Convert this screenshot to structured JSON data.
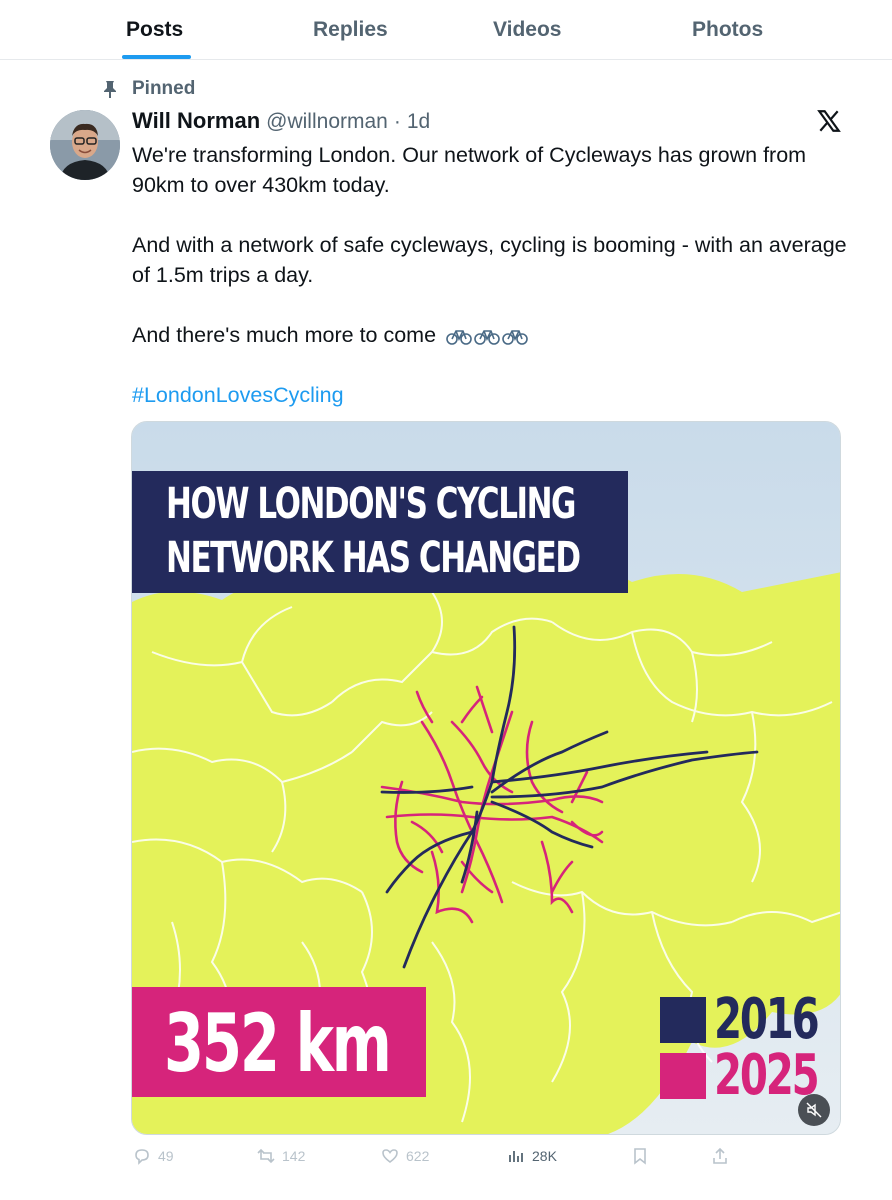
{
  "tabs": [
    {
      "label": "Posts",
      "active": true
    },
    {
      "label": "Replies",
      "active": false
    },
    {
      "label": "Videos",
      "active": false
    },
    {
      "label": "Photos",
      "active": false
    }
  ],
  "pinned_label": "Pinned",
  "author": {
    "display_name": "Will Norman",
    "handle": "@willnorman",
    "separator": "·",
    "time": "1d"
  },
  "tweet": {
    "paragraph_1": "We're transforming London. Our network of Cycleways has grown from 90km to over 430km today.",
    "paragraph_2": "And with a network of safe cycleways, cycling is booming - with an average of 1.5m trips a day.",
    "paragraph_3": "And there's much more to come",
    "emoji": "🚲🚲🚲",
    "hashtag": "#LondonLovesCycling"
  },
  "media": {
    "title_line_1": "HOW LONDON'S CYCLING",
    "title_line_2": "NETWORK HAS CHANGED",
    "distance": "352 km",
    "legend": [
      {
        "year": "2016",
        "color": "#232a5c"
      },
      {
        "year": "2025",
        "color": "#d6247b"
      }
    ],
    "map_fill": "#e4f25a",
    "sky": "#dfe8ef",
    "mute_icon": "speaker-muted-icon"
  },
  "actions": {
    "replies": "49",
    "reposts": "142",
    "likes": "622",
    "views": "28K"
  },
  "colors": {
    "accent": "#1d9bf0",
    "secondary_text": "#536471"
  }
}
